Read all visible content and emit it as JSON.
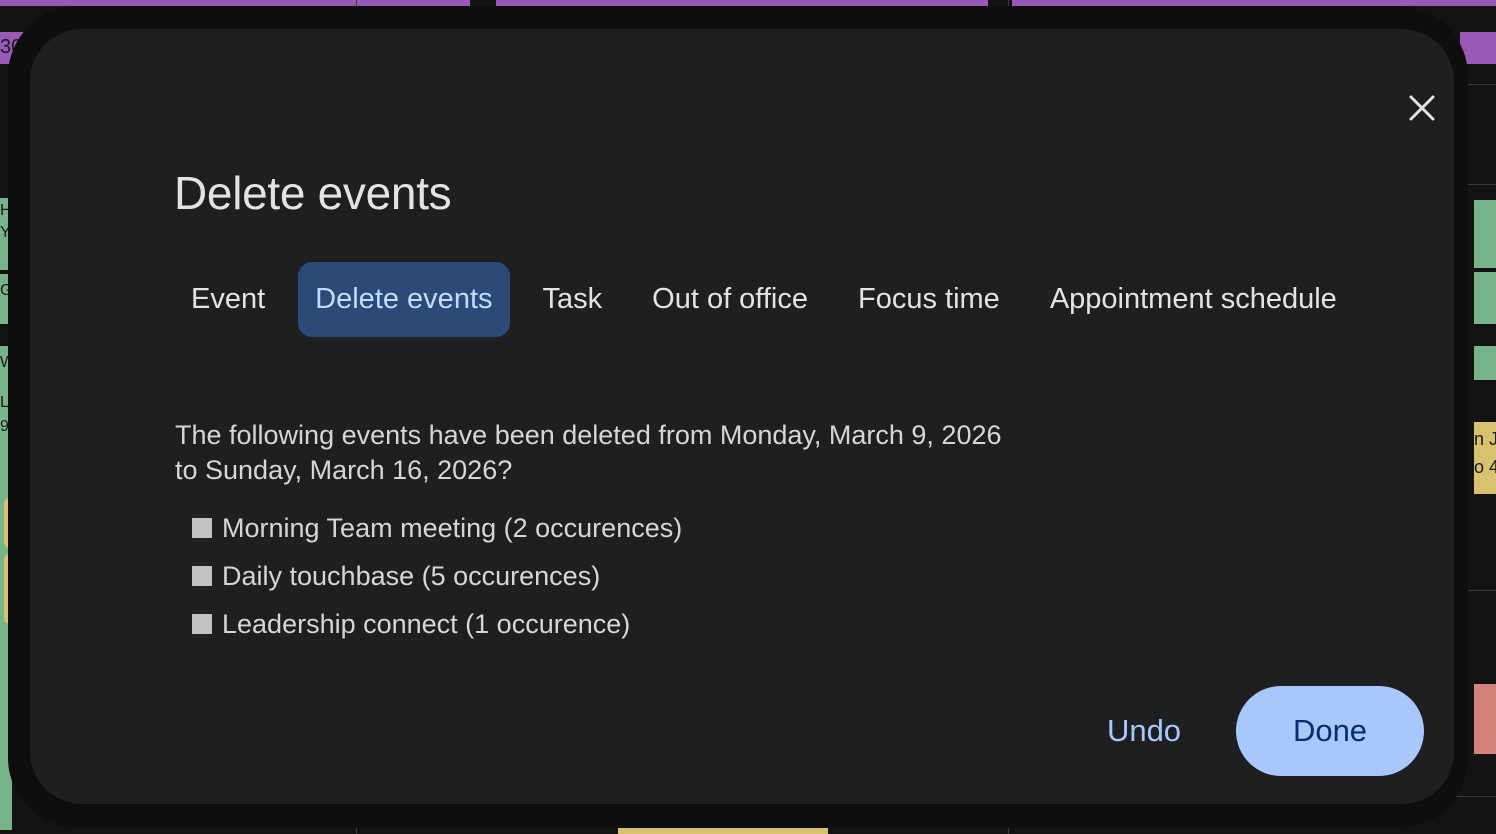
{
  "dialog": {
    "title": "Delete events",
    "tabs": [
      {
        "label": "Event",
        "active": false
      },
      {
        "label": "Delete events",
        "active": true
      },
      {
        "label": "Task",
        "active": false
      },
      {
        "label": "Out of office",
        "active": false
      },
      {
        "label": "Focus time",
        "active": false
      },
      {
        "label": "Appointment schedule",
        "active": false
      }
    ],
    "message_line1": "The following events have been deleted from Monday, March 9, 2026",
    "message_line2": "to Sunday, March 16, 2026?",
    "deleted_items": [
      "Morning Team meeting (2 occurences)",
      "Daily touchbase (5 occurences)",
      "Leadership connect (1 occurence)"
    ],
    "undo_label": "Undo",
    "done_label": "Done",
    "close_icon": "close-icon"
  },
  "background": {
    "fragments": [
      "30m",
      "H",
      "YC",
      "G",
      "W",
      "Li",
      "9:",
      "n J",
      "o 4"
    ]
  },
  "colors": {
    "dialog_bg": "#1e1f21",
    "active_tab_bg": "#2b4a78",
    "active_tab_text": "#c6dbff",
    "primary_button": "#a8c7fa",
    "primary_button_text": "#062e6f",
    "event_purple": "#9b59b6",
    "event_green": "#79b38a",
    "event_yellow": "#d9c16f",
    "event_salmon": "#d3837a"
  }
}
